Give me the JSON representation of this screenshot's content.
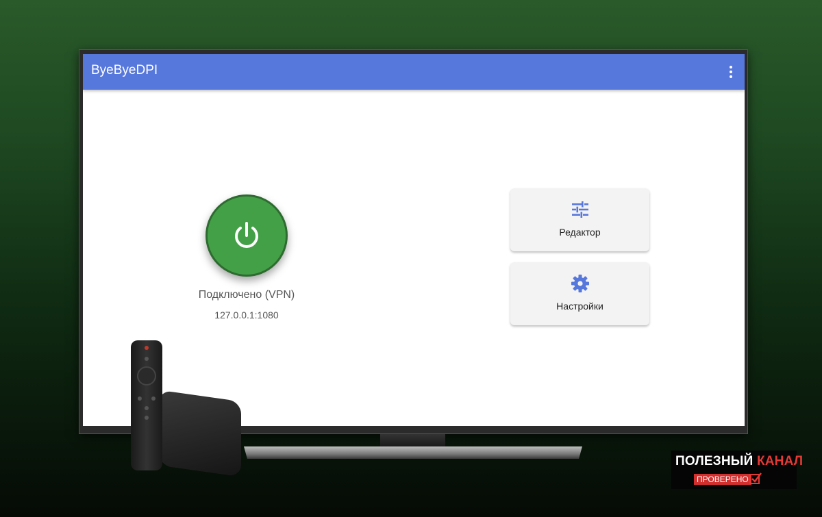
{
  "app": {
    "title": "ByeByeDPI",
    "menu_icon": "more-vert-icon",
    "accent_color": "#5677dc"
  },
  "status": {
    "power_icon": "power-icon",
    "button_color": "#43a047",
    "state_text": "Подключено (VPN)",
    "address": "127.0.0.1:1080"
  },
  "actions": [
    {
      "icon": "tune-sliders-icon",
      "label": "Редактор"
    },
    {
      "icon": "gear-icon",
      "label": "Настройки"
    }
  ],
  "watermark": {
    "title_part1": "ПОЛЕЗНЫЙ",
    "title_part2": "КАНАЛ",
    "subtitle": "ПРОВЕРЕНО",
    "check_icon": "checkbox-check-icon"
  }
}
